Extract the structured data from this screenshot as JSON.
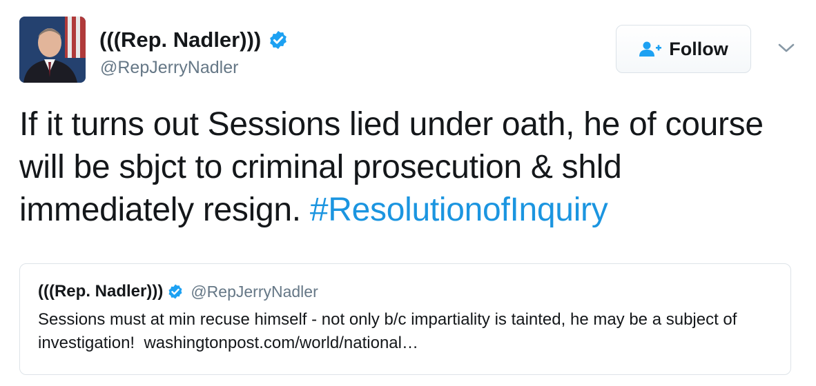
{
  "author": {
    "display_name": "(((Rep. Nadler)))",
    "handle": "@RepJerryNadler",
    "verified": true
  },
  "follow_button": {
    "label": "Follow"
  },
  "tweet": {
    "text": "If it turns out Sessions lied under oath, he of course will be sbjct to criminal prosecution & shld immediately resign.",
    "hashtag": "#ResolutionofInquiry"
  },
  "quoted_tweet": {
    "display_name": "(((Rep. Nadler)))",
    "handle": "@RepJerryNadler",
    "text": "Sessions must at min recuse himself - not only b/c impartiality is tainted, he may be a subject of investigation!",
    "link": "washingtonpost.com/world/national…"
  },
  "colors": {
    "link_blue": "#1b95e0",
    "verified_blue": "#1da1f2",
    "secondary_text": "#657786"
  }
}
